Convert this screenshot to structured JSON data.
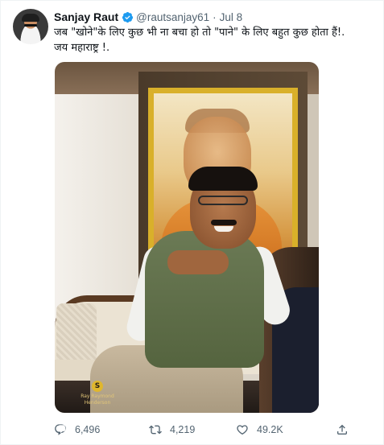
{
  "tweet": {
    "author_name": "Sanjay Raut",
    "handle": "@rautsanjay61",
    "separator": "·",
    "date": "Jul 8",
    "text_line1": "जब \"खोने\"के लिए कुछ भी ना बचा हो तो \"पाने\" के लिए बहुत कुछ होता हैं!.",
    "text_line2": "जय महाराष्ट्र !.",
    "media_watermark": "Ray Raymond Henderson",
    "media_watermark_logo": "S"
  },
  "actions": {
    "replies": "6,496",
    "retweets": "4,219",
    "likes": "49.2K"
  },
  "colors": {
    "verified": "#1d9bf0",
    "secondary_text": "#536471",
    "primary_text": "#0f1419"
  },
  "icons": {
    "reply": "reply-icon",
    "retweet": "retweet-icon",
    "like": "heart-icon",
    "share": "share-icon",
    "verified": "verified-badge-icon"
  }
}
